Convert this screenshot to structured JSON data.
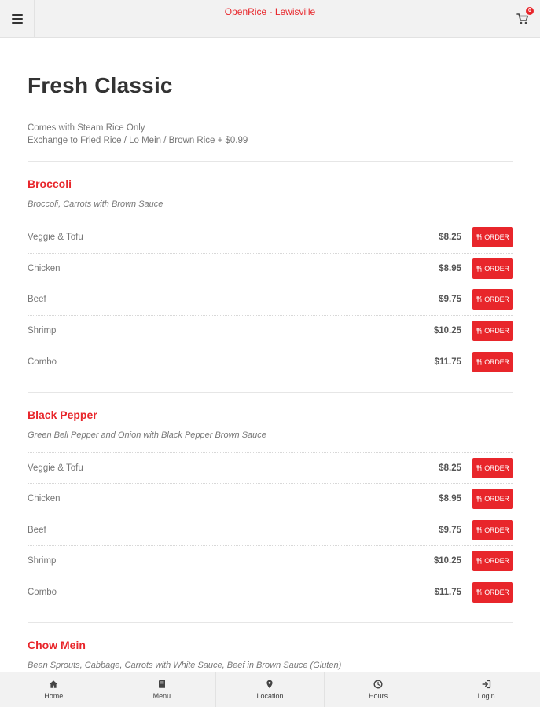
{
  "header": {
    "title": "OpenRice - Lewisville",
    "cart_count": "0",
    "menu_icon": "hamburger-icon",
    "cart_icon": "shopping-cart-icon"
  },
  "page": {
    "title": "Fresh Classic",
    "note_line1": "Comes with Steam Rice Only",
    "note_line2": "Exchange to Fried Rice / Lo Mein / Brown Rice + $0.99"
  },
  "order_label": "ORDER",
  "order_icon": "utensils-icon",
  "accent_color": "#e8262b",
  "sections": [
    {
      "title": "Broccoli",
      "description": "Broccoli, Carrots with Brown Sauce",
      "items": [
        {
          "name": "Veggie & Tofu",
          "price": "$8.25"
        },
        {
          "name": "Chicken",
          "price": "$8.95"
        },
        {
          "name": "Beef",
          "price": "$9.75"
        },
        {
          "name": "Shrimp",
          "price": "$10.25"
        },
        {
          "name": "Combo",
          "price": "$11.75"
        }
      ]
    },
    {
      "title": "Black Pepper",
      "description": "Green Bell Pepper and Onion with Black Pepper Brown Sauce",
      "items": [
        {
          "name": "Veggie & Tofu",
          "price": "$8.25"
        },
        {
          "name": "Chicken",
          "price": "$8.95"
        },
        {
          "name": "Beef",
          "price": "$9.75"
        },
        {
          "name": "Shrimp",
          "price": "$10.25"
        },
        {
          "name": "Combo",
          "price": "$11.75"
        }
      ]
    },
    {
      "title": "Chow Mein",
      "description": "Bean Sprouts, Cabbage, Carrots with White Sauce, Beef in Brown Sauce (Gluten)"
    }
  ],
  "bottom_nav": [
    {
      "label": "Home",
      "icon": "home-icon"
    },
    {
      "label": "Menu",
      "icon": "book-icon"
    },
    {
      "label": "Location",
      "icon": "map-pin-icon"
    },
    {
      "label": "Hours",
      "icon": "clock-icon"
    },
    {
      "label": "Login",
      "icon": "sign-in-icon"
    }
  ]
}
